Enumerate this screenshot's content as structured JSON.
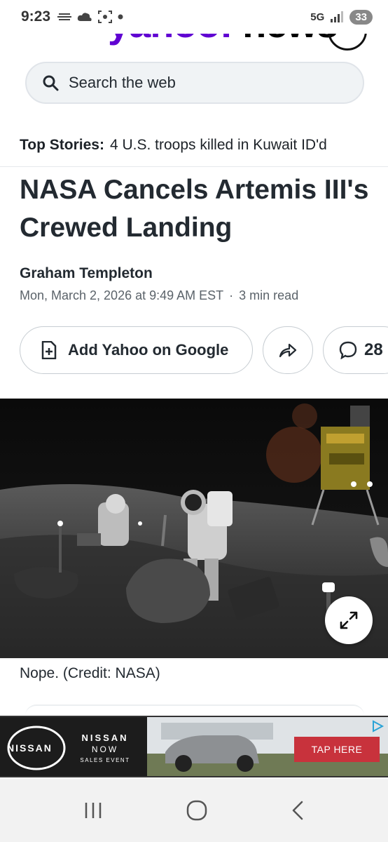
{
  "status_bar": {
    "time": "9:23",
    "network": "5G",
    "battery": "33"
  },
  "header": {
    "brand_yahoo": "yahoo!",
    "brand_news": "news"
  },
  "search": {
    "placeholder": "Search the web"
  },
  "top_stories": {
    "label": "Top Stories:",
    "text": "4 U.S. troops killed in Kuwait ID'd"
  },
  "article": {
    "headline": "NASA Cancels Artemis III's Crewed Landing",
    "author": "Graham Templeton",
    "date": "Mon, March 2, 2026 at 9:49 AM EST",
    "separator": "·",
    "read_time": "3 min read",
    "add_google_label": "Add Yahoo on Google",
    "comment_count": "28",
    "caption": "Nope. (Credit: NASA)"
  },
  "ad": {
    "brand": "NISSAN",
    "line1": "NISSAN",
    "line2": "NOW",
    "line3": "SALES EVENT",
    "cta": "TAP HERE"
  },
  "colors": {
    "brand_purple": "#6001d2",
    "ad_cta": "#c8323c"
  }
}
